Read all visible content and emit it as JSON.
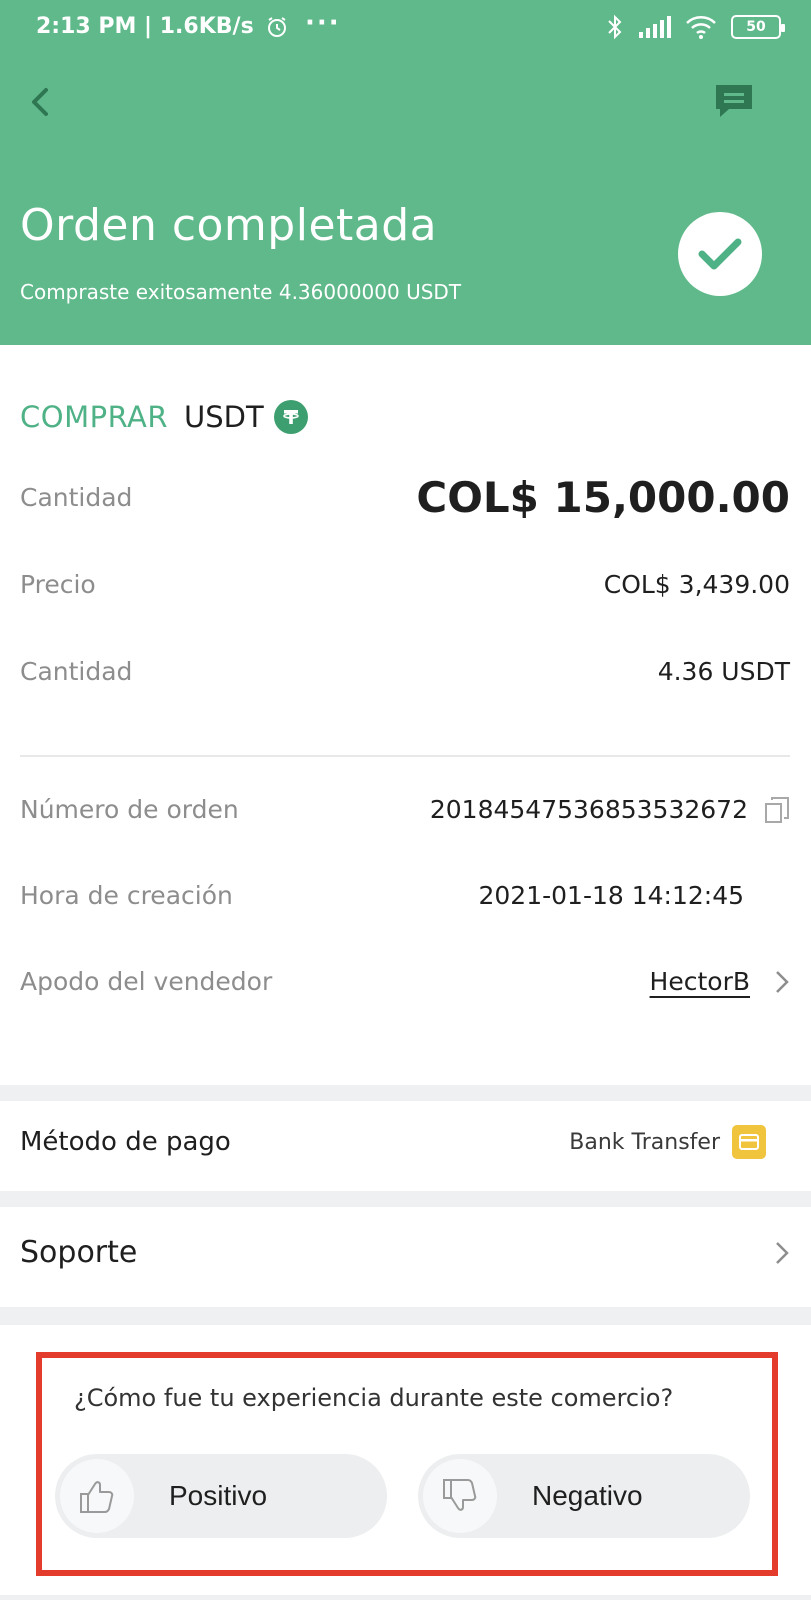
{
  "status_bar": {
    "time_speed": "2:13 PM | 1.6KB/s",
    "dots": "···",
    "battery": "50"
  },
  "header": {
    "title": "Orden completada",
    "subtitle": "Compraste exitosamente  4.36000000 USDT",
    "background_color": "#5fb98a"
  },
  "order": {
    "side": "COMPRAR",
    "asset": "USDT",
    "rows": [
      {
        "label": "Cantidad",
        "value": "COL$ 15,000.00"
      },
      {
        "label": "Precio",
        "value": "COL$ 3,439.00"
      },
      {
        "label": "Cantidad",
        "value": "4.36 USDT"
      }
    ],
    "details": [
      {
        "label": "Número de orden",
        "value": "20184547536853532672"
      },
      {
        "label": "Hora de creación",
        "value": "2021-01-18 14:12:45"
      },
      {
        "label": "Apodo del vendedor",
        "value": "HectorB"
      }
    ]
  },
  "payment": {
    "label": "Método de pago",
    "method": "Bank Transfer"
  },
  "support": {
    "label": "Soporte"
  },
  "feedback": {
    "question": "¿Cómo fue tu experiencia durante este comercio?",
    "positive": "Positivo",
    "negative": "Negativo",
    "highlight_color": "#e43c2c"
  },
  "icons": [
    "back-icon",
    "chat-icon",
    "check-icon",
    "tether-icon",
    "copy-icon",
    "chevron-right-icon",
    "bank-card-icon",
    "thumbs-up-icon",
    "thumbs-down-icon"
  ]
}
